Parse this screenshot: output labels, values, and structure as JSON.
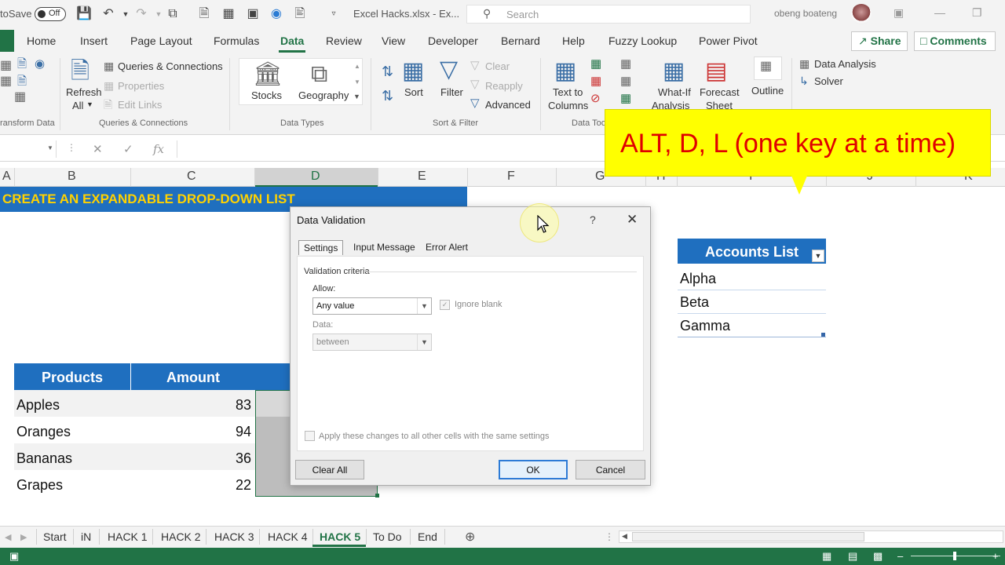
{
  "titlebar": {
    "autosave_label": "toSave",
    "autosave_state": "Off",
    "filename": "Excel Hacks.xlsx  -  Ex...",
    "search_placeholder": "Search",
    "username": "obeng boateng"
  },
  "menu": {
    "items": [
      "Home",
      "Insert",
      "Page Layout",
      "Formulas",
      "Data",
      "Review",
      "View",
      "Developer",
      "Bernard",
      "Help",
      "Fuzzy Lookup",
      "Power Pivot"
    ],
    "active": "Data",
    "share_label": "Share",
    "comments_label": "Comments"
  },
  "ribbon": {
    "group_transform": "ransform Data",
    "queries_connections": "Queries & Connections",
    "properties": "Properties",
    "edit_links": "Edit Links",
    "refresh_all_1": "Refresh",
    "refresh_all_2": "All",
    "group_queries": "Queries & Connections",
    "stocks": "Stocks",
    "geography": "Geography",
    "group_datatypes": "Data Types",
    "sort": "Sort",
    "filter": "Filter",
    "clear": "Clear",
    "reapply": "Reapply",
    "advanced": "Advanced",
    "group_sortfilter": "Sort & Filter",
    "text_to_columns_1": "Text to",
    "text_to_columns_2": "Columns",
    "group_datatools": "Data Too",
    "whatif_1": "What-If",
    "whatif_2": "Analysis",
    "forecast_1": "Forecast",
    "forecast_2": "Sheet",
    "outline": "Outline",
    "data_analysis": "Data Analysis",
    "solver": "Solver"
  },
  "columns": [
    "A",
    "B",
    "C",
    "D",
    "E",
    "F",
    "G",
    "H",
    "I",
    "J",
    "K"
  ],
  "selected_column": "D",
  "banner": "CREATE AN EXPANDABLE DROP-DOWN LIST",
  "table": {
    "headers": [
      "Products",
      "Amount"
    ],
    "rows": [
      {
        "product": "Apples",
        "amount": "83"
      },
      {
        "product": "Oranges",
        "amount": "94"
      },
      {
        "product": "Bananas",
        "amount": "36"
      },
      {
        "product": "Grapes",
        "amount": "22"
      }
    ]
  },
  "accounts": {
    "header": "Accounts List",
    "items": [
      "Alpha",
      "Beta",
      "Gamma"
    ]
  },
  "callout": "ALT, D, L (one key at a time)",
  "dialog": {
    "title": "Data Validation",
    "help": "?",
    "tabs": [
      "Settings",
      "Input Message",
      "Error Alert"
    ],
    "active_tab": "Settings",
    "criteria_label": "Validation criteria",
    "allow_label": "Allow:",
    "allow_value": "Any value",
    "ignore_blank": "Ignore blank",
    "data_label": "Data:",
    "data_value": "between",
    "apply_all": "Apply these changes to all other cells with the same settings",
    "clear_all": "Clear All",
    "ok": "OK",
    "cancel": "Cancel"
  },
  "sheets": {
    "tabs": [
      "Start",
      "iN",
      "HACK 1",
      "HACK 2",
      "HACK 3",
      "HACK 4",
      "HACK 5",
      "To Do",
      "End"
    ],
    "active": "HACK 5"
  },
  "colors": {
    "excel_green": "#217346",
    "table_blue": "#1f6fbf",
    "banner_text": "#ffd200",
    "callout_bg": "#ffff00",
    "callout_text": "#e00000"
  }
}
